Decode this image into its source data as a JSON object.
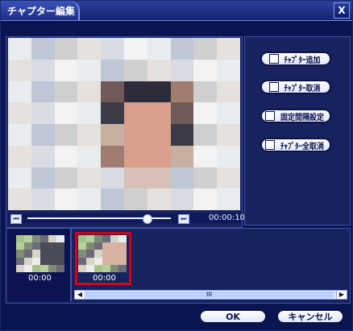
{
  "window": {
    "title": "チャプター編集",
    "close_label": "X"
  },
  "preview": {
    "time": "00:00:10",
    "seek_left_icon": "skip-back-icon",
    "seek_right_icon": "skip-forward-icon"
  },
  "side_buttons": [
    {
      "label": "ﾁｬﾌﾟﾀｰ追加",
      "icon": "chapter-add-icon"
    },
    {
      "label": "ﾁｬﾌﾟﾀｰ取消",
      "icon": "chapter-remove-icon"
    },
    {
      "label": "固定間隔設定",
      "icon": "interval-setting-icon"
    },
    {
      "label": "ﾁｬﾌﾟﾀｰ全取消",
      "icon": "chapter-remove-all-icon"
    }
  ],
  "thumbnails": [
    {
      "time": "00:00"
    },
    {
      "time": "00:00"
    }
  ],
  "scrollbar": {
    "grip": "III"
  },
  "footer": {
    "ok_label": "OK",
    "cancel_label": "キャンセル"
  },
  "colors": {
    "accent": "#0a1450",
    "selection": "#d10016"
  }
}
